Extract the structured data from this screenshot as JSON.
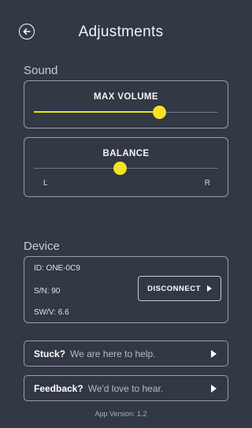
{
  "header": {
    "title": "Adjustments",
    "back_icon": "arrow-left-circle-icon"
  },
  "sound": {
    "section_label": "Sound",
    "max_volume": {
      "label": "MAX VOLUME",
      "value": 0.68
    },
    "balance": {
      "label": "BALANCE",
      "value": 0.47,
      "left_label": "L",
      "right_label": "R"
    }
  },
  "device": {
    "section_label": "Device",
    "id": "ID: ONE-0C9",
    "sn": "S/N: 90",
    "swv": "SW/V: 6.6",
    "disconnect_label": "DISCONNECT"
  },
  "links": {
    "stuck": {
      "strong": "Stuck?",
      "soft": "We are here to help."
    },
    "feedback": {
      "strong": "Feedback?",
      "soft": "We'd love to hear."
    }
  },
  "footer": {
    "version": "App Version: 1.2"
  },
  "colors": {
    "accent": "#f2e420",
    "background": "#323844",
    "border": "#9aa0a9"
  }
}
